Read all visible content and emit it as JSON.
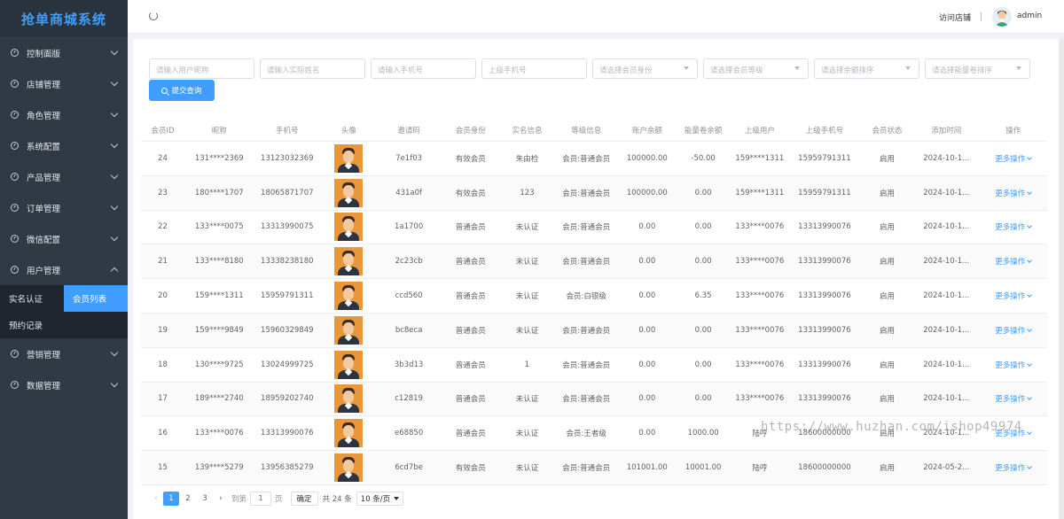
{
  "app": {
    "title": "抢单商城系统"
  },
  "sidebar": {
    "items": [
      {
        "label": "控制面版",
        "expanded": false
      },
      {
        "label": "店铺管理",
        "expanded": false
      },
      {
        "label": "角色管理",
        "expanded": false
      },
      {
        "label": "系统配置",
        "expanded": false
      },
      {
        "label": "产品管理",
        "expanded": false
      },
      {
        "label": "订单管理",
        "expanded": false
      },
      {
        "label": "微信配置",
        "expanded": false
      },
      {
        "label": "用户管理",
        "expanded": true
      }
    ],
    "submenu": {
      "realname": "实名认证",
      "member_list": "会员列表",
      "reservation": "预约记录"
    },
    "items_after": [
      {
        "label": "营销管理"
      },
      {
        "label": "数据管理"
      }
    ]
  },
  "topbar": {
    "visit": "访问店铺",
    "user": "admin"
  },
  "filters": {
    "nickname": "请输入用户昵称",
    "realname": "请输入实际姓名",
    "phone": "请输入手机号",
    "parent_phone": "上级手机号",
    "identity": "请选择会员身份",
    "level": "请选择会员等级",
    "balance_sort": "请选择余额排序",
    "energy_sort": "请选择能量卷排序",
    "submit": "提交查询"
  },
  "table": {
    "headers": [
      "会员ID",
      "昵称",
      "手机号",
      "头像",
      "邀请码",
      "会员身份",
      "实名信息",
      "等级信息",
      "账户余额",
      "能量卷余额",
      "上级用户",
      "上级手机号",
      "会员状态",
      "添加时间",
      "操作"
    ],
    "rows": [
      [
        "24",
        "131****2369",
        "13123032369",
        "",
        "7e1f03",
        "有效会员",
        "朱由检",
        "会员:普通会员",
        "100000.00",
        "-50.00",
        "159****1311",
        "15959791311",
        "启用",
        "2024-10-1...",
        "更多操作"
      ],
      [
        "23",
        "180****1707",
        "18065871707",
        "",
        "431a0f",
        "有效会员",
        "123",
        "会员:普通会员",
        "100000.00",
        "0.00",
        "159****1311",
        "15959791311",
        "启用",
        "2024-10-1...",
        "更多操作"
      ],
      [
        "22",
        "133****0075",
        "13313990075",
        "",
        "1a1700",
        "普通会员",
        "未认证",
        "会员:普通会员",
        "0.00",
        "0.00",
        "133****0076",
        "13313990076",
        "启用",
        "2024-10-1...",
        "更多操作"
      ],
      [
        "21",
        "133****8180",
        "13338238180",
        "",
        "2c23cb",
        "普通会员",
        "未认证",
        "会员:普通会员",
        "0.00",
        "0.00",
        "133****0076",
        "13313990076",
        "启用",
        "2024-10-1...",
        "更多操作"
      ],
      [
        "20",
        "159****1311",
        "15959791311",
        "",
        "ccd560",
        "普通会员",
        "未认证",
        "会员:白银级",
        "0.00",
        "6.35",
        "133****0076",
        "13313990076",
        "启用",
        "2024-10-1...",
        "更多操作"
      ],
      [
        "19",
        "159****9849",
        "15960329849",
        "",
        "bc8eca",
        "普通会员",
        "未认证",
        "会员:普通会员",
        "0.00",
        "0.00",
        "133****0076",
        "13313990076",
        "启用",
        "2024-10-1...",
        "更多操作"
      ],
      [
        "18",
        "130****9725",
        "13024999725",
        "",
        "3b3d13",
        "普通会员",
        "1",
        "会员:普通会员",
        "0.00",
        "0.00",
        "133****0076",
        "13313990076",
        "启用",
        "2024-10-1...",
        "更多操作"
      ],
      [
        "17",
        "189****2740",
        "18959202740",
        "",
        "c12819",
        "普通会员",
        "未认证",
        "会员:普通会员",
        "0.00",
        "0.00",
        "133****0076",
        "13313990076",
        "启用",
        "2024-10-1...",
        "更多操作"
      ],
      [
        "16",
        "133****0076",
        "13313990076",
        "",
        "e68850",
        "普通会员",
        "未认证",
        "会员:王者级",
        "0.00",
        "1000.00",
        "陆哼",
        "18600000000",
        "启用",
        "2024-10-1...",
        "更多操作"
      ],
      [
        "15",
        "139****5279",
        "13956385279",
        "",
        "6cd7be",
        "有效会员",
        "未认证",
        "会员:普通会员",
        "101001.00",
        "10001.00",
        "陆哼",
        "18600000000",
        "启用",
        "2024-05-2...",
        "更多操作"
      ]
    ]
  },
  "pagination": {
    "pages": [
      "1",
      "2",
      "3"
    ],
    "current": "1",
    "goto_label": "到第",
    "goto_value": "1",
    "page_unit": "页",
    "confirm": "确定",
    "total": "共 24 条",
    "page_size": "10 条/页"
  },
  "watermark": "https://www.huzhan.com/ishop49974",
  "colors": {
    "primary": "#409eff",
    "sidebar_bg": "#2f3a45",
    "logo": "#409eff"
  }
}
